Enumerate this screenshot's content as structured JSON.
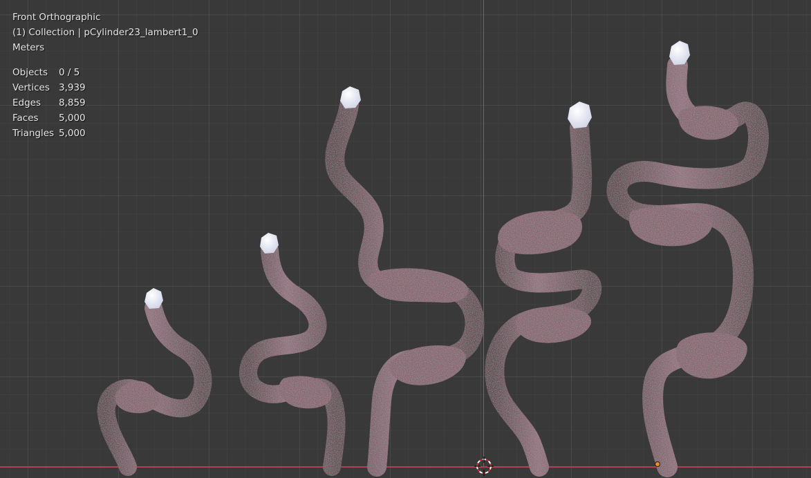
{
  "viewport": {
    "view_name": "Front Orthographic",
    "collection_info": "(1) Collection | pCylinder23_lambert1_0",
    "units": "Meters"
  },
  "stats": [
    {
      "label": "Objects",
      "value": "0 / 5"
    },
    {
      "label": "Vertices",
      "value": "3,939"
    },
    {
      "label": "Edges",
      "value": "8,859"
    },
    {
      "label": "Faces",
      "value": "5,000"
    },
    {
      "label": "Triangles",
      "value": "5,000"
    }
  ],
  "colors": {
    "background": "#393939",
    "axis_x": "#b3414f",
    "axis_z": "#4b6ea6",
    "tendril": "#8a6276",
    "tip": "#e6e8f2",
    "origin": "#f08a24"
  },
  "icons": [
    "3d-cursor-icon",
    "origin-point-icon"
  ]
}
